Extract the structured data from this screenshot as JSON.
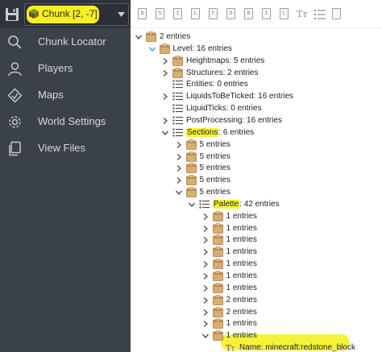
{
  "app": {
    "chunk_selector": {
      "label": "Chunk [2, -7]"
    },
    "nav": [
      {
        "label": "Chunk Locator",
        "icon": "search-icon"
      },
      {
        "label": "Players",
        "icon": "person-icon"
      },
      {
        "label": "Maps",
        "icon": "map-icon"
      },
      {
        "label": "World Settings",
        "icon": "gear-icon"
      },
      {
        "label": "View Files",
        "icon": "files-icon"
      }
    ],
    "toolbar": {
      "buttons": [
        "B",
        "S",
        "I",
        "L",
        "F",
        "D",
        "B",
        "I",
        "L",
        "Tт",
        "list"
      ]
    },
    "colors": {
      "sidebar": "#3a4149",
      "topbar": "#2e343b",
      "highlight": "#f3f33a",
      "icon_gold": "#c89b5e",
      "chevron": "#555555"
    }
  },
  "tree": [
    {
      "depth": 0,
      "chev": "down",
      "icon": "compound",
      "key": "",
      "text": "2 entries"
    },
    {
      "depth": 1,
      "chev": "down",
      "icon": "compound",
      "key": "Level",
      "text": ": 16 entries",
      "chev_color": "#3ba0d8"
    },
    {
      "depth": 2,
      "chev": "right",
      "icon": "compound",
      "key": "Heightmaps",
      "text": ": 5 entries"
    },
    {
      "depth": 2,
      "chev": "right",
      "icon": "compound",
      "key": "Structures",
      "text": ": 2 entries"
    },
    {
      "depth": 2,
      "chev": "",
      "icon": "list",
      "key": "Entities",
      "text": ": 0 entries"
    },
    {
      "depth": 2,
      "chev": "right",
      "icon": "list",
      "key": "LiquidsToBeTicked",
      "text": ": 16 entries"
    },
    {
      "depth": 2,
      "chev": "",
      "icon": "list",
      "key": "LiquidTicks",
      "text": ": 0 entries"
    },
    {
      "depth": 2,
      "chev": "right",
      "icon": "list",
      "key": "PostProcessing",
      "text": ": 16 entries"
    },
    {
      "depth": 2,
      "chev": "down",
      "icon": "list",
      "key": "Sections",
      "text": ": 6 entries",
      "highlight": true
    },
    {
      "depth": 3,
      "chev": "right",
      "icon": "compound",
      "key": "",
      "text": "5 entries"
    },
    {
      "depth": 3,
      "chev": "right",
      "icon": "compound",
      "key": "",
      "text": "5 entries"
    },
    {
      "depth": 3,
      "chev": "right",
      "icon": "compound",
      "key": "",
      "text": "5 entries"
    },
    {
      "depth": 3,
      "chev": "right",
      "icon": "compound",
      "key": "",
      "text": "5 entries"
    },
    {
      "depth": 3,
      "chev": "down",
      "icon": "compound",
      "key": "",
      "text": "5 entries"
    },
    {
      "depth": 4,
      "chev": "down",
      "icon": "list",
      "key": "Palette",
      "text": ": 42 entries",
      "highlight": true
    },
    {
      "depth": 5,
      "chev": "right",
      "icon": "compound",
      "key": "",
      "text": "1 entries"
    },
    {
      "depth": 5,
      "chev": "right",
      "icon": "compound",
      "key": "",
      "text": "1 entries"
    },
    {
      "depth": 5,
      "chev": "right",
      "icon": "compound",
      "key": "",
      "text": "1 entries"
    },
    {
      "depth": 5,
      "chev": "right",
      "icon": "compound",
      "key": "",
      "text": "1 entries"
    },
    {
      "depth": 5,
      "chev": "right",
      "icon": "compound",
      "key": "",
      "text": "1 entries"
    },
    {
      "depth": 5,
      "chev": "right",
      "icon": "compound",
      "key": "",
      "text": "1 entries"
    },
    {
      "depth": 5,
      "chev": "right",
      "icon": "compound",
      "key": "",
      "text": "1 entries"
    },
    {
      "depth": 5,
      "chev": "right",
      "icon": "compound",
      "key": "",
      "text": "2 entries"
    },
    {
      "depth": 5,
      "chev": "right",
      "icon": "compound",
      "key": "",
      "text": "2 entries"
    },
    {
      "depth": 5,
      "chev": "right",
      "icon": "compound",
      "key": "",
      "text": "1 entries"
    },
    {
      "depth": 5,
      "chev": "down",
      "icon": "compound",
      "key": "",
      "text": "1 entries"
    },
    {
      "depth": 6,
      "chev": "",
      "icon": "string",
      "key": "",
      "text": "Name: minecraft:redstone_block",
      "highlight_row": true
    }
  ]
}
